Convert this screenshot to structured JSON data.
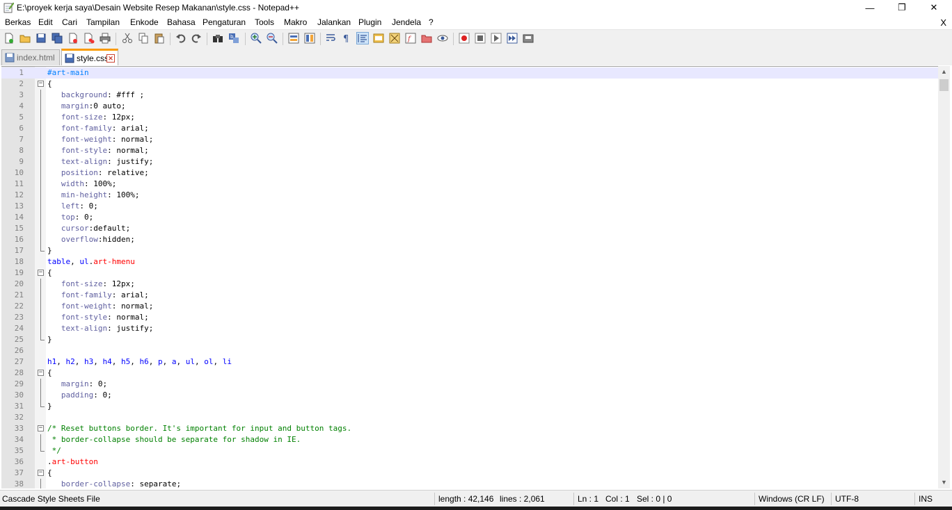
{
  "window": {
    "title": "E:\\proyek kerja saya\\Desain Website Resep Makanan\\style.css - Notepad++",
    "minimize_glyph": "—",
    "restore_glyph": "❐",
    "close_glyph": "✕"
  },
  "menu": {
    "items": [
      "Berkas",
      "Edit",
      "Cari",
      "Tampilan",
      "Enkode",
      "Bahasa",
      "Pengaturan",
      "Tools",
      "Makro",
      "Jalankan",
      "Plugin",
      "Jendela",
      "?"
    ],
    "close_glyph": "X"
  },
  "toolbar": {
    "icons": [
      "new-file-icon",
      "open-file-icon",
      "save-icon",
      "save-all-icon",
      "close-icon",
      "close-all-icon",
      "print-icon",
      "cut-icon",
      "copy-icon",
      "paste-icon",
      "undo-icon",
      "redo-icon",
      "find-icon",
      "replace-icon",
      "zoom-in-icon",
      "zoom-out-icon",
      "sync-vertical-icon",
      "sync-horizontal-icon",
      "word-wrap-icon",
      "show-all-chars-icon",
      "indent-guide-icon",
      "user-language-icon",
      "doc-map-icon",
      "function-list-icon",
      "folder-workspace-icon",
      "monitor-icon",
      "record-macro-icon",
      "stop-record-icon",
      "play-macro-icon",
      "run-macro-multiple-icon",
      "save-macro-icon"
    ]
  },
  "tabs": [
    {
      "label": "index.html",
      "active": false
    },
    {
      "label": "style.css",
      "active": true,
      "close_glyph": "✕"
    }
  ],
  "editor": {
    "current_line": 1,
    "lines": [
      {
        "n": "1",
        "fold": "",
        "parts": [
          [
            "c-id",
            "#art-main"
          ]
        ]
      },
      {
        "n": "2",
        "fold": "open",
        "parts": [
          [
            "c-pun",
            "{"
          ]
        ]
      },
      {
        "n": "3",
        "fold": "",
        "parts": [
          [
            "c-pun",
            "   "
          ],
          [
            "c-prop",
            "background"
          ],
          [
            "c-pun",
            ": "
          ],
          [
            "c-val",
            "#fff ;"
          ]
        ]
      },
      {
        "n": "4",
        "fold": "",
        "parts": [
          [
            "c-pun",
            "   "
          ],
          [
            "c-prop",
            "margin"
          ],
          [
            "c-pun",
            ":"
          ],
          [
            "c-val",
            "0 auto;"
          ]
        ]
      },
      {
        "n": "5",
        "fold": "",
        "parts": [
          [
            "c-pun",
            "   "
          ],
          [
            "c-prop",
            "font-size"
          ],
          [
            "c-pun",
            ": "
          ],
          [
            "c-val",
            "12px;"
          ]
        ]
      },
      {
        "n": "6",
        "fold": "",
        "parts": [
          [
            "c-pun",
            "   "
          ],
          [
            "c-prop",
            "font-family"
          ],
          [
            "c-pun",
            ": "
          ],
          [
            "c-val",
            "arial;"
          ]
        ]
      },
      {
        "n": "7",
        "fold": "",
        "parts": [
          [
            "c-pun",
            "   "
          ],
          [
            "c-prop",
            "font-weight"
          ],
          [
            "c-pun",
            ": "
          ],
          [
            "c-val",
            "normal;"
          ]
        ]
      },
      {
        "n": "8",
        "fold": "",
        "parts": [
          [
            "c-pun",
            "   "
          ],
          [
            "c-prop",
            "font-style"
          ],
          [
            "c-pun",
            ": "
          ],
          [
            "c-val",
            "normal;"
          ]
        ]
      },
      {
        "n": "9",
        "fold": "",
        "parts": [
          [
            "c-pun",
            "   "
          ],
          [
            "c-prop",
            "text-align"
          ],
          [
            "c-pun",
            ": "
          ],
          [
            "c-val",
            "justify;"
          ]
        ]
      },
      {
        "n": "10",
        "fold": "",
        "parts": [
          [
            "c-pun",
            "   "
          ],
          [
            "c-prop",
            "position"
          ],
          [
            "c-pun",
            ": "
          ],
          [
            "c-val",
            "relative;"
          ]
        ]
      },
      {
        "n": "11",
        "fold": "",
        "parts": [
          [
            "c-pun",
            "   "
          ],
          [
            "c-prop",
            "width"
          ],
          [
            "c-pun",
            ": "
          ],
          [
            "c-val",
            "100%;"
          ]
        ]
      },
      {
        "n": "12",
        "fold": "",
        "parts": [
          [
            "c-pun",
            "   "
          ],
          [
            "c-prop",
            "min-height"
          ],
          [
            "c-pun",
            ": "
          ],
          [
            "c-val",
            "100%;"
          ]
        ]
      },
      {
        "n": "13",
        "fold": "",
        "parts": [
          [
            "c-pun",
            "   "
          ],
          [
            "c-prop",
            "left"
          ],
          [
            "c-pun",
            ": "
          ],
          [
            "c-val",
            "0;"
          ]
        ]
      },
      {
        "n": "14",
        "fold": "",
        "parts": [
          [
            "c-pun",
            "   "
          ],
          [
            "c-prop",
            "top"
          ],
          [
            "c-pun",
            ": "
          ],
          [
            "c-val",
            "0;"
          ]
        ]
      },
      {
        "n": "15",
        "fold": "",
        "parts": [
          [
            "c-pun",
            "   "
          ],
          [
            "c-prop",
            "cursor"
          ],
          [
            "c-pun",
            ":"
          ],
          [
            "c-val",
            "default;"
          ]
        ]
      },
      {
        "n": "16",
        "fold": "",
        "parts": [
          [
            "c-pun",
            "   "
          ],
          [
            "c-prop",
            "overflow"
          ],
          [
            "c-pun",
            ":"
          ],
          [
            "c-val",
            "hidden;"
          ]
        ]
      },
      {
        "n": "17",
        "fold": "end",
        "parts": [
          [
            "c-pun",
            "}"
          ]
        ]
      },
      {
        "n": "18",
        "fold": "",
        "parts": [
          [
            "c-sel",
            "table"
          ],
          [
            "c-pun",
            ", "
          ],
          [
            "c-sel",
            "ul"
          ],
          [
            "c-pun",
            "."
          ],
          [
            "c-cls",
            "art-hmenu"
          ]
        ]
      },
      {
        "n": "19",
        "fold": "open",
        "parts": [
          [
            "c-pun",
            "{"
          ]
        ]
      },
      {
        "n": "20",
        "fold": "",
        "parts": [
          [
            "c-pun",
            "   "
          ],
          [
            "c-prop",
            "font-size"
          ],
          [
            "c-pun",
            ": "
          ],
          [
            "c-val",
            "12px;"
          ]
        ]
      },
      {
        "n": "21",
        "fold": "",
        "parts": [
          [
            "c-pun",
            "   "
          ],
          [
            "c-prop",
            "font-family"
          ],
          [
            "c-pun",
            ": "
          ],
          [
            "c-val",
            "arial;"
          ]
        ]
      },
      {
        "n": "22",
        "fold": "",
        "parts": [
          [
            "c-pun",
            "   "
          ],
          [
            "c-prop",
            "font-weight"
          ],
          [
            "c-pun",
            ": "
          ],
          [
            "c-val",
            "normal;"
          ]
        ]
      },
      {
        "n": "23",
        "fold": "",
        "parts": [
          [
            "c-pun",
            "   "
          ],
          [
            "c-prop",
            "font-style"
          ],
          [
            "c-pun",
            ": "
          ],
          [
            "c-val",
            "normal;"
          ]
        ]
      },
      {
        "n": "24",
        "fold": "",
        "parts": [
          [
            "c-pun",
            "   "
          ],
          [
            "c-prop",
            "text-align"
          ],
          [
            "c-pun",
            ": "
          ],
          [
            "c-val",
            "justify;"
          ]
        ]
      },
      {
        "n": "25",
        "fold": "end",
        "parts": [
          [
            "c-pun",
            "}"
          ]
        ]
      },
      {
        "n": "26",
        "fold": "",
        "parts": []
      },
      {
        "n": "27",
        "fold": "",
        "parts": [
          [
            "c-sel",
            "h1"
          ],
          [
            "c-pun",
            ", "
          ],
          [
            "c-sel",
            "h2"
          ],
          [
            "c-pun",
            ", "
          ],
          [
            "c-sel",
            "h3"
          ],
          [
            "c-pun",
            ", "
          ],
          [
            "c-sel",
            "h4"
          ],
          [
            "c-pun",
            ", "
          ],
          [
            "c-sel",
            "h5"
          ],
          [
            "c-pun",
            ", "
          ],
          [
            "c-sel",
            "h6"
          ],
          [
            "c-pun",
            ", "
          ],
          [
            "c-sel",
            "p"
          ],
          [
            "c-pun",
            ", "
          ],
          [
            "c-sel",
            "a"
          ],
          [
            "c-pun",
            ", "
          ],
          [
            "c-sel",
            "ul"
          ],
          [
            "c-pun",
            ", "
          ],
          [
            "c-sel",
            "ol"
          ],
          [
            "c-pun",
            ", "
          ],
          [
            "c-sel",
            "li"
          ]
        ]
      },
      {
        "n": "28",
        "fold": "open",
        "parts": [
          [
            "c-pun",
            "{"
          ]
        ]
      },
      {
        "n": "29",
        "fold": "",
        "parts": [
          [
            "c-pun",
            "   "
          ],
          [
            "c-prop",
            "margin"
          ],
          [
            "c-pun",
            ": "
          ],
          [
            "c-val",
            "0;"
          ]
        ]
      },
      {
        "n": "30",
        "fold": "",
        "parts": [
          [
            "c-pun",
            "   "
          ],
          [
            "c-prop",
            "padding"
          ],
          [
            "c-pun",
            ": "
          ],
          [
            "c-val",
            "0;"
          ]
        ]
      },
      {
        "n": "31",
        "fold": "end",
        "parts": [
          [
            "c-pun",
            "}"
          ]
        ]
      },
      {
        "n": "32",
        "fold": "",
        "parts": []
      },
      {
        "n": "33",
        "fold": "open",
        "parts": [
          [
            "c-com",
            "/* Reset buttons border. It's important for input and button tags."
          ]
        ]
      },
      {
        "n": "34",
        "fold": "",
        "parts": [
          [
            "c-com",
            " * border-collapse should be separate for shadow in IE."
          ]
        ]
      },
      {
        "n": "35",
        "fold": "end",
        "parts": [
          [
            "c-com",
            " */"
          ]
        ]
      },
      {
        "n": "36",
        "fold": "",
        "parts": [
          [
            "c-pun",
            "."
          ],
          [
            "c-cls",
            "art-button"
          ]
        ]
      },
      {
        "n": "37",
        "fold": "open",
        "parts": [
          [
            "c-pun",
            "{"
          ]
        ]
      },
      {
        "n": "38",
        "fold": "",
        "parts": [
          [
            "c-pun",
            "   "
          ],
          [
            "c-prop",
            "border-collapse"
          ],
          [
            "c-pun",
            ": "
          ],
          [
            "c-val",
            "separate;"
          ]
        ]
      }
    ]
  },
  "scrollbar": {
    "up_glyph": "▲",
    "down_glyph": "▼"
  },
  "statusbar": {
    "file_type": "Cascade Style Sheets File",
    "length": "length : 42,146",
    "lines": "lines : 2,061",
    "ln": "Ln : 1",
    "col": "Col : 1",
    "sel": "Sel : 0 | 0",
    "eol": "Windows (CR LF)",
    "encoding": "UTF-8",
    "mode": "INS"
  }
}
